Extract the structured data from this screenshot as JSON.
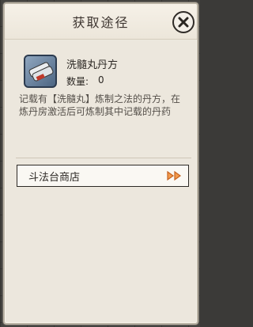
{
  "dialog": {
    "title": "获取途径",
    "close_icon": "close-x-icon"
  },
  "item": {
    "icon": "scroll-recipe-icon",
    "name": "洗髓丸丹方",
    "quantity_label": "数量:",
    "quantity_value": "0",
    "description": "记载有【洗髓丸】炼制之法的丹方，在炼丹房激活后可炼制其中记载的丹药"
  },
  "sources": [
    {
      "label": "斗法台商店",
      "icon": "double-arrow-right-icon"
    }
  ],
  "colors": {
    "panel_bg": "#ece7dd",
    "arrow_accent": "#e07b2f",
    "text_dark": "#2c2824"
  }
}
